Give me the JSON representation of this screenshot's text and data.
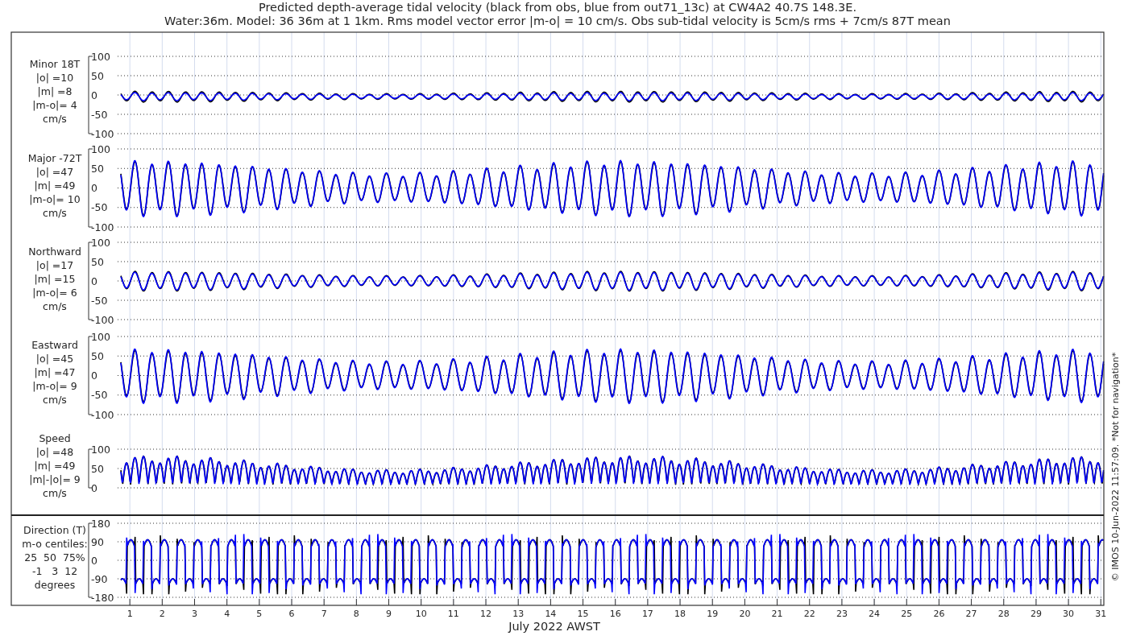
{
  "title": [
    "Predicted depth-average tidal velocity (black from obs, blue from out71_13c) at CW4A2 40.7S 148.3E.",
    "Water:36m. Model: 36 36m at 1 1km. Rms model vector error |m-o| = 10 cm/s. Obs sub-tidal velocity is 5cm/s rms + 7cm/s 87T mean"
  ],
  "panels": [
    {
      "kind": "velocity",
      "label": [
        "Minor 18T",
        "|o| =10",
        "|m| =8",
        "|m-o|= 4",
        "cm/s"
      ],
      "yticks": [
        "100",
        "50",
        "0",
        "-50",
        "-100"
      ]
    },
    {
      "kind": "velocity",
      "label": [
        "Major -72T",
        "|o| =47",
        "|m| =49",
        "|m-o|= 10",
        "cm/s"
      ],
      "yticks": [
        "100",
        "50",
        "0",
        "-50",
        "-100"
      ]
    },
    {
      "kind": "velocity",
      "label": [
        "Northward",
        "|o| =17",
        "|m| =15",
        "|m-o|= 6",
        "cm/s"
      ],
      "yticks": [
        "100",
        "50",
        "0",
        "-50",
        "-100"
      ]
    },
    {
      "kind": "velocity",
      "label": [
        "Eastward",
        "|o| =45",
        "|m| =47",
        "|m-o|= 9",
        "cm/s"
      ],
      "yticks": [
        "100",
        "50",
        "0",
        "-50",
        "-100"
      ]
    },
    {
      "kind": "speed",
      "label": [
        "Speed",
        "|o| =48",
        "|m| =49",
        "|m|-|o|= 9",
        "cm/s"
      ],
      "yticks": [
        "100",
        "50",
        "0"
      ]
    },
    {
      "kind": "direction",
      "label": [
        "Direction (T)",
        "m-o centiles:",
        "25  50  75%",
        "-1   3  12",
        "degrees"
      ],
      "yticks": [
        "180",
        "90",
        "0",
        "-90",
        "-180"
      ]
    }
  ],
  "x_axis": {
    "ticks": [
      "1",
      "2",
      "3",
      "4",
      "5",
      "6",
      "7",
      "8",
      "9",
      "10",
      "11",
      "12",
      "13",
      "14",
      "15",
      "16",
      "17",
      "18",
      "19",
      "20",
      "21",
      "22",
      "23",
      "24",
      "25",
      "26",
      "27",
      "28",
      "29",
      "30",
      "31"
    ],
    "label": "July 2022 AWST"
  },
  "credit": "© IMOS 10-Jun-2022 11:57:09. *Not for navigation*"
}
